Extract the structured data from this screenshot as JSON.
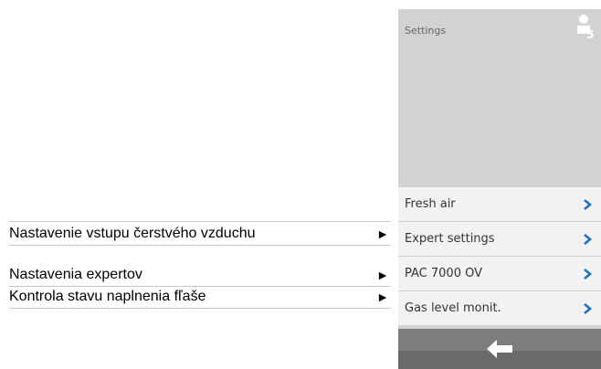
{
  "annotations": [
    {
      "label": "Nastavenie vstupu čerstvého vzduchu",
      "arrow": "►"
    },
    {
      "label": "Nastavenia expertov",
      "arrow": "►"
    },
    {
      "label": "Kontrola stavu naplnenia fľaše",
      "arrow": "►"
    }
  ],
  "panel": {
    "title": "Settings",
    "user_level": "5",
    "menu_items": [
      {
        "label": "Fresh air"
      },
      {
        "label": "Expert settings"
      },
      {
        "label": "PAC 7000 OV"
      },
      {
        "label": "Gas level monit."
      }
    ]
  },
  "colors": {
    "accent": "#1a73c8",
    "panel_bg": "#d2d2d2",
    "menu_bg": "#f2f2f2",
    "footer_bg": "#7d7d7d"
  },
  "icons": {
    "user": "user-level-icon",
    "chevron": "chevron-right-icon",
    "back": "arrow-left-icon"
  }
}
